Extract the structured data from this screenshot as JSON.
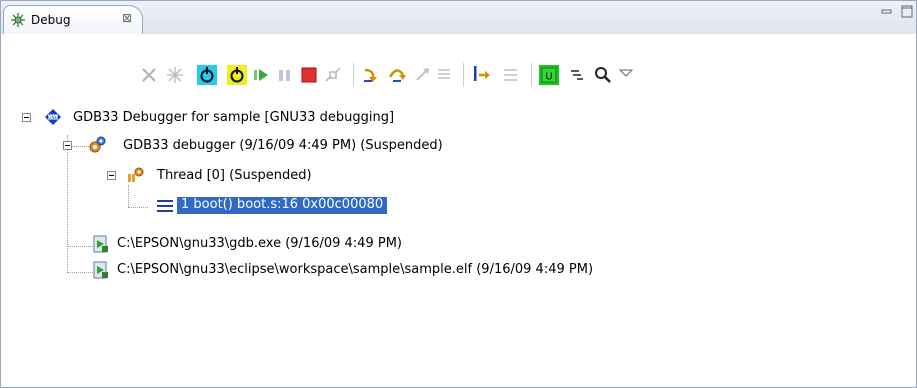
{
  "view": {
    "tab_title": "Debug",
    "tab_close": "⊠"
  },
  "toolbar": {
    "buttons": [
      "remove-all-terminated",
      "relaunch",
      "resume-cyan",
      "resume-yellow",
      "resume",
      "suspend",
      "terminate",
      "disconnect",
      "step-into",
      "step-over",
      "step-return",
      "drop-to-frame",
      "instruction-stepping",
      "use-step-filters",
      "mode-u",
      "thread-mode",
      "search",
      "view-menu"
    ]
  },
  "tree": {
    "launch": "GDB33 Debugger for sample [GNU33 debugging]",
    "debugger": "GDB33 debugger (9/16/09 4:49 PM) (Suspended)",
    "thread": "Thread [0] (Suspended)",
    "frame": "1 boot() boot.s:16 0x00c00080",
    "process1": "C:\\EPSON\\gnu33\\gdb.exe (9/16/09 4:49 PM)",
    "process2": "C:\\EPSON\\gnu33\\eclipse\\workspace\\sample\\sample.elf (9/16/09 4:49 PM)"
  },
  "colors": {
    "selection": "#316ac5",
    "border": "#98a8c0"
  }
}
